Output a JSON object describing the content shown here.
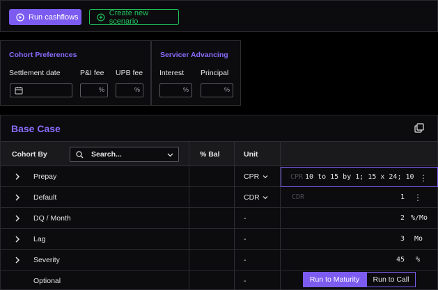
{
  "toolbar": {
    "run_label": "Run cashflows",
    "new_label": "Create new scenario"
  },
  "cohort_prefs": {
    "title": "Cohort Preferences",
    "settlement_label": "Settlement date",
    "pi_fee_label": "P&I fee",
    "upb_fee_label": "UPB fee",
    "pct": "%"
  },
  "servicer": {
    "title": "Servicer Advancing",
    "interest_label": "Interest",
    "principal_label": "Principal",
    "pct": "%"
  },
  "section": {
    "title": "Base Case"
  },
  "table": {
    "cohort_by": "Cohort By",
    "search_placeholder": "Search...",
    "pct_bal": "% Bal",
    "unit": "Unit"
  },
  "rows": [
    {
      "name": "Prepay",
      "unit": "CPR",
      "prefix": "CPR",
      "value": "10 to 15 by 1; 15 x 24; 10"
    },
    {
      "name": "Default",
      "unit": "CDR",
      "prefix": "CDR",
      "value": "1"
    },
    {
      "name": "DQ / Month",
      "unit": "-",
      "value": "2",
      "suffix": "%/Mo"
    },
    {
      "name": "Lag",
      "unit": "-",
      "value": "3",
      "suffix": "Mo"
    },
    {
      "name": "Severity",
      "unit": "-",
      "value": "45",
      "suffix": "%"
    },
    {
      "name": "Optional",
      "unit": "-"
    }
  ],
  "optional": {
    "maturity_label": "Run to Maturity",
    "call_label": "Run to Call"
  },
  "colors": {
    "accent": "#7c5cf0",
    "green": "#22c55e"
  }
}
